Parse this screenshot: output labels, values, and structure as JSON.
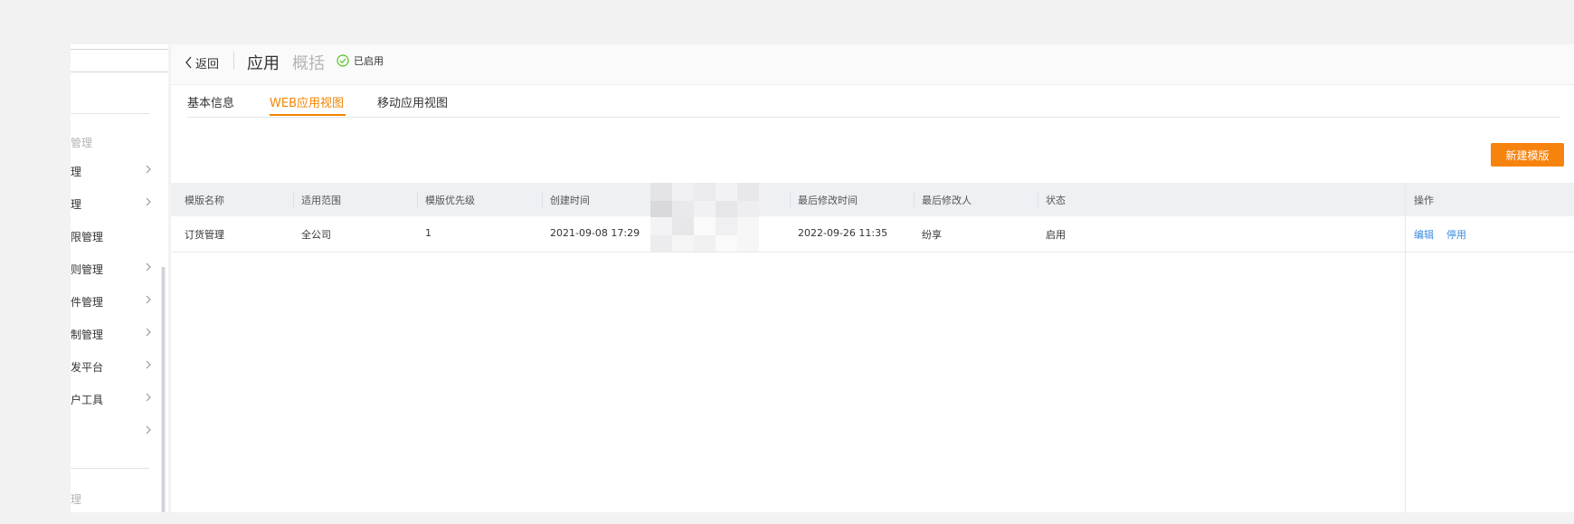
{
  "sidebar": {
    "search_placeholder": "",
    "group_title_top": "管理",
    "items": [
      {
        "label": "理",
        "arrow": true
      },
      {
        "label": "理",
        "arrow": true
      },
      {
        "label": "限管理",
        "arrow": false
      },
      {
        "label": "则管理",
        "arrow": true
      },
      {
        "label": "件管理",
        "arrow": true
      },
      {
        "label": "制管理",
        "arrow": true
      },
      {
        "label": "发平台",
        "arrow": true
      },
      {
        "label": "户工具",
        "arrow": true
      },
      {
        "label": "",
        "arrow": true
      }
    ],
    "group_title_bottom": "理"
  },
  "header": {
    "back_label": "返回",
    "title": "应用",
    "subtitle": "概括",
    "status": "已启用",
    "status_color": "#52c41a"
  },
  "tabs": [
    {
      "label": "基本信息",
      "active": false
    },
    {
      "label": "WEB应用视图",
      "active": true
    },
    {
      "label": "移动应用视图",
      "active": false
    }
  ],
  "accent_color": "#f28500",
  "new_template_button": "新建模版",
  "table": {
    "headers": [
      "模版名称",
      "适用范围",
      "模版优先级",
      "创建时间",
      "",
      "最后修改时间",
      "最后修改人",
      "状态",
      "操作"
    ],
    "rows": [
      {
        "name": "订货管理",
        "scope": "全公司",
        "priority": "1",
        "created": "2021-09-08 17:29",
        "creator": "",
        "modified": "2022-09-26 11:35",
        "modifier": "纷享",
        "status": "启用",
        "actions": [
          "编辑",
          "停用"
        ]
      }
    ]
  }
}
